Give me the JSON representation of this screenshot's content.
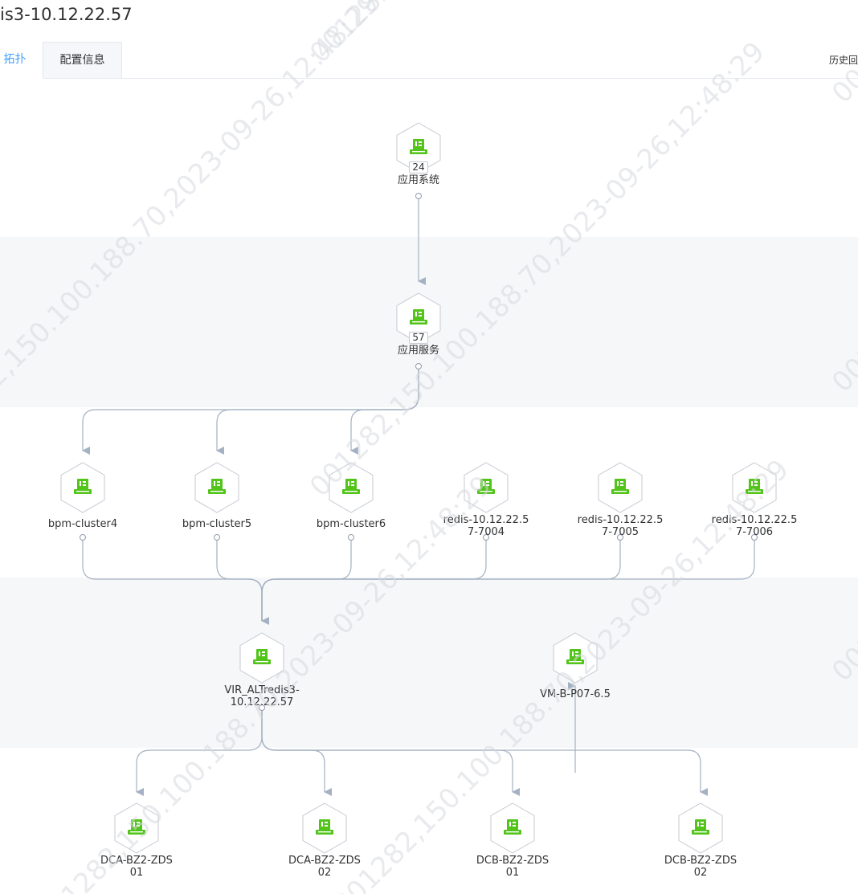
{
  "header": {
    "title": "is3-10.12.22.57"
  },
  "tabs": [
    {
      "label": "拓扑",
      "active": true
    },
    {
      "label": "配置信息",
      "active": false
    }
  ],
  "history_link": "历史回溯",
  "nodes": {
    "app_system": {
      "label": "应用系统",
      "count": "24"
    },
    "app_service": {
      "label": "应用服务",
      "count": "57"
    },
    "bpm_cluster4": {
      "label": "bpm-cluster4"
    },
    "bpm_cluster5": {
      "label": "bpm-cluster5"
    },
    "bpm_cluster6": {
      "label": "bpm-cluster6"
    },
    "redis_7004": {
      "label": "redis-10.12.22.57-7004"
    },
    "redis_7005": {
      "label": "redis-10.12.22.57-7005"
    },
    "redis_7006": {
      "label": "redis-10.12.22.57-7006"
    },
    "vir_altredis3": {
      "label": "VIR_ALTredis3-10.12.22.57"
    },
    "vm_b_p07": {
      "label": "VM-B-P07-6.5"
    },
    "dca_01": {
      "label": "DCA-BZ2-ZDS01"
    },
    "dca_02": {
      "label": "DCA-BZ2-ZDS02"
    },
    "dcb_01": {
      "label": "DCB-BZ2-ZDS01"
    },
    "dcb_02": {
      "label": "DCB-BZ2-ZDS02"
    }
  },
  "edges": [
    [
      "app_system",
      "app_service"
    ],
    [
      "app_service",
      "bpm_cluster4"
    ],
    [
      "app_service",
      "bpm_cluster5"
    ],
    [
      "app_service",
      "bpm_cluster6"
    ],
    [
      "bpm_cluster4",
      "vir_altredis3"
    ],
    [
      "bpm_cluster5",
      "vir_altredis3"
    ],
    [
      "bpm_cluster6",
      "vir_altredis3"
    ],
    [
      "redis_7004",
      "vir_altredis3"
    ],
    [
      "redis_7005",
      "vir_altredis3"
    ],
    [
      "redis_7006",
      "vir_altredis3"
    ],
    [
      "vir_altredis3",
      "dca_01"
    ],
    [
      "vir_altredis3",
      "dca_02"
    ],
    [
      "vir_altredis3",
      "dcb_01"
    ],
    [
      "vir_altredis3",
      "dcb_02"
    ],
    [
      "vir_altredis3",
      "vm_b_p07"
    ]
  ],
  "watermark": "001282,150.100.188.70,2023-09-26,12:48:29",
  "colors": {
    "icon_green": "#52c41a",
    "edge": "#a3b1c2",
    "tab_active": "#409eff",
    "band": "#f6f7f9"
  }
}
